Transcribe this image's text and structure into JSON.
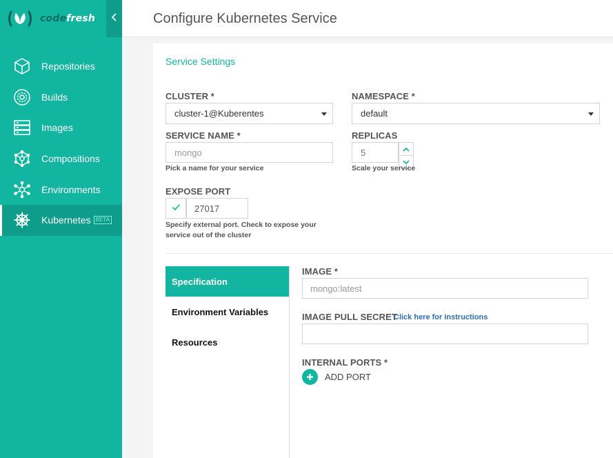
{
  "app": {
    "logo_left": "code",
    "logo_right": "fresh"
  },
  "sidebar": {
    "items": [
      {
        "label": "Repositories",
        "icon": "cube-icon"
      },
      {
        "label": "Builds",
        "icon": "gear-icon"
      },
      {
        "label": "Images",
        "icon": "stack-icon"
      },
      {
        "label": "Compositions",
        "icon": "network-icon"
      },
      {
        "label": "Environments",
        "icon": "hub-icon"
      },
      {
        "label": "Kubernetes",
        "icon": "helm-icon",
        "badge": "BETA",
        "active": true
      }
    ]
  },
  "header": {
    "title": "Configure Kubernetes Service"
  },
  "form": {
    "section_title": "Service Settings",
    "cluster": {
      "label": "CLUSTER *",
      "value": "cluster-1@Kuberentes"
    },
    "namespace": {
      "label": "NAMESPACE *",
      "value": "default"
    },
    "service_name": {
      "label": "SERVICE NAME *",
      "placeholder": "mongo",
      "hint": "Pick a name for your service"
    },
    "replicas": {
      "label": "REPLICAS",
      "value": "5",
      "hint": "Scale your service"
    },
    "expose_port": {
      "label": "EXPOSE PORT",
      "value": "27017",
      "checked": true,
      "hint": "Specify external port. Check to expose your service out of the cluster"
    }
  },
  "tabs": [
    {
      "label": "Specification",
      "active": true
    },
    {
      "label": "Environment Variables"
    },
    {
      "label": "Resources"
    }
  ],
  "spec": {
    "image": {
      "label": "IMAGE *",
      "placeholder": "mongo:latest"
    },
    "pull_secret": {
      "label": "IMAGE PULL SECRET",
      "link": "Click here for instructions",
      "value": ""
    },
    "internal_ports": {
      "label": "INTERNAL PORTS *",
      "add_label": "ADD PORT"
    }
  },
  "colors": {
    "accent": "#12b5a0",
    "accent_dark": "#0f9d8b",
    "link": "#2a6db8"
  }
}
